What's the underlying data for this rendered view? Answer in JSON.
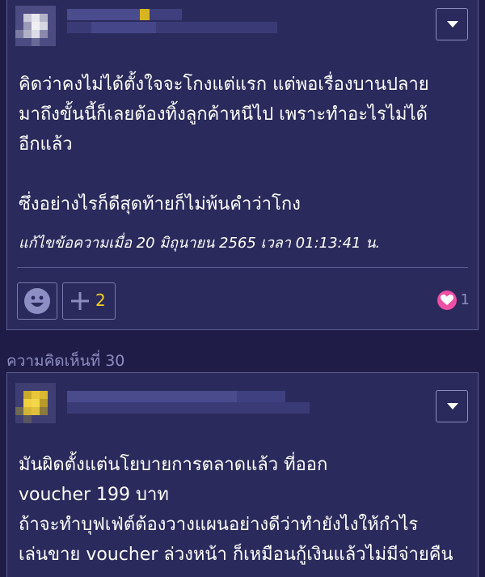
{
  "comments": [
    {
      "author": {
        "avatar": "pixelated-avatar",
        "name": ""
      },
      "menu_icon": "chevron-down-icon",
      "body": "คิดว่าคงไม่ได้ตั้งใจจะโกงแต่แรก   แต่พอเรื่องบานปลาย\nมาถึงขั้นนี้ก็เลยต้องทิ้งลูกค้าหนีไป   เพราะทำอะไรไม่ได้\nอีกแล้ว\n\nซึ่งอย่างไรก็ดีสุดท้ายก็ไม่พ้นคำว่าโกง",
      "edit_note": "แก้ไขข้อความเมื่อ 20 มิถุนายน 2565 เวลา 01:13:41 น.",
      "actions": {
        "emoji_icon": "smiley-icon",
        "plus_icon": "plus-icon",
        "plus_count": "2",
        "heart_icon": "heart-icon",
        "heart_count": "1"
      }
    },
    {
      "label": "ความคิดเห็นที่ 30",
      "author": {
        "avatar": "pixelated-avatar",
        "name": ""
      },
      "menu_icon": "chevron-down-icon",
      "body": "มันผิดตั้งแต่นโยบายการตลาดแล้ว ที่ออก\nvoucher  199 บาท\nถ้าจะทำบุฟเฟ่ต์ต้องวางแผนอย่างดีว่าทำยังไงให้กำไร\nเล่นขาย voucher ล่วงหน้า ก็เหมือนกู้เงินแล้วไม่มีจ่ายคืน"
    }
  ],
  "colors": {
    "background": "#1f1d48",
    "card": "#2a2a5c",
    "border": "#5d5c92",
    "accent_yellow": "#f2d21f",
    "accent_pink": "#ee4fa4",
    "muted_text": "#8e8dbf"
  }
}
